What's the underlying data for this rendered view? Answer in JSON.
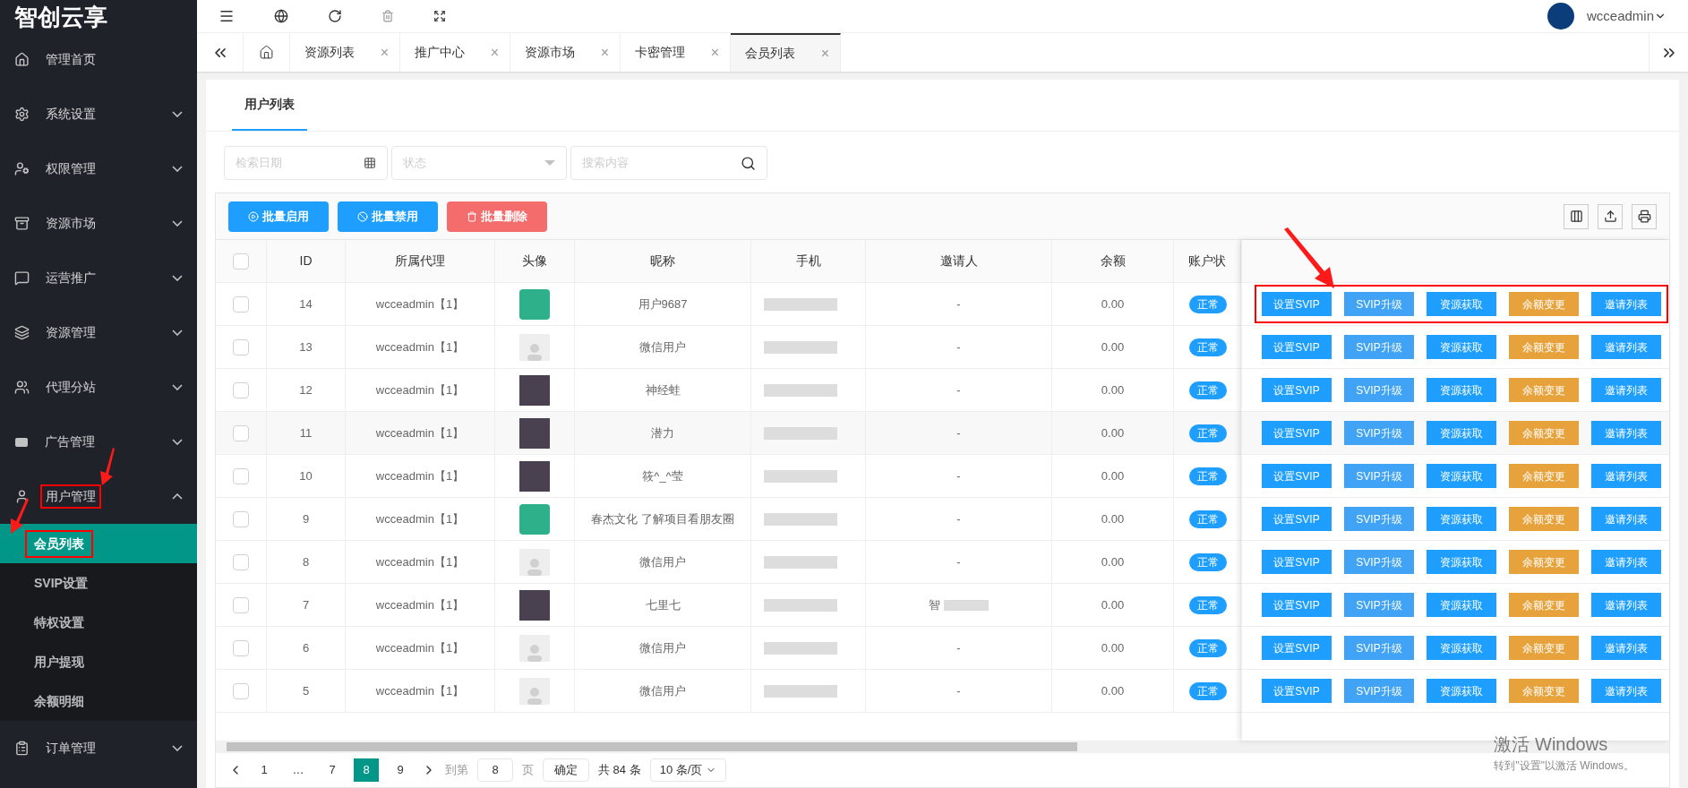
{
  "brand": {
    "name": "智创云享"
  },
  "user": {
    "name": "wcceadmin"
  },
  "sidebar": {
    "items": [
      {
        "label": "管理首页",
        "highlighted": false
      },
      {
        "label": "系统设置",
        "expandable": true,
        "expanded": false,
        "highlighted": false
      },
      {
        "label": "权限管理",
        "expandable": true,
        "expanded": false,
        "highlighted": false
      },
      {
        "label": "资源市场",
        "expandable": true,
        "expanded": false,
        "highlighted": false
      },
      {
        "label": "运营推广",
        "expandable": true,
        "expanded": false,
        "highlighted": false
      },
      {
        "label": "资源管理",
        "expandable": true,
        "expanded": false,
        "highlighted": false
      },
      {
        "label": "代理分站",
        "expandable": true,
        "expanded": false,
        "highlighted": false
      },
      {
        "label": "广告管理",
        "expandable": true,
        "expanded": false,
        "highlighted": false
      },
      {
        "label": "用户管理",
        "expandable": true,
        "expanded": true,
        "highlighted": true,
        "children": [
          {
            "label": "会员列表",
            "selected": true,
            "highlighted": true
          },
          {
            "label": "SVIP设置",
            "selected": false,
            "highlighted": false
          },
          {
            "label": "特权设置",
            "selected": false,
            "highlighted": false
          },
          {
            "label": "用户提现",
            "selected": false,
            "highlighted": false
          },
          {
            "label": "余额明细",
            "selected": false,
            "highlighted": false
          }
        ]
      },
      {
        "label": "订单管理",
        "expandable": true,
        "expanded": false,
        "highlighted": false
      }
    ]
  },
  "tabs": [
    {
      "label": "资源列表",
      "selected": false
    },
    {
      "label": "推广中心",
      "selected": false
    },
    {
      "label": "资源市场",
      "selected": false
    },
    {
      "label": "卡密管理",
      "selected": false
    },
    {
      "label": "会员列表",
      "selected": true
    }
  ],
  "close_glyph": "×",
  "subtabs": [
    {
      "label": "用户列表",
      "selected": true
    }
  ],
  "filters": {
    "date": {
      "placeholder": "检索日期"
    },
    "status": {
      "placeholder": "状态"
    },
    "search": {
      "placeholder": "搜索内容"
    }
  },
  "bulk_buttons": [
    {
      "label": "批量启用",
      "kind": "enable",
      "color": "#1e9fff"
    },
    {
      "label": "批量禁用",
      "kind": "disable",
      "color": "#1e9fff"
    },
    {
      "label": "批量删除",
      "kind": "delete",
      "color": "#f56c6c"
    }
  ],
  "table": {
    "all_checked": false,
    "columns": [
      "ID",
      "所属代理",
      "头像",
      "昵称",
      "手机",
      "邀请人",
      "余额",
      "账户状"
    ],
    "rows": [
      {
        "checked": false,
        "id": "14",
        "agent": "wcceadmin【1】",
        "avatar": {
          "kind": "logo"
        },
        "nickname": "用户9687",
        "inviter": "-",
        "inviter_hidden": false,
        "balance": "0.00",
        "status": "正常",
        "highlighted": true,
        "actions": [
          {
            "label": "设置SVIP",
            "color": "#1e9fff"
          },
          {
            "label": "SVIP升级",
            "color": "#40a3f5"
          },
          {
            "label": "资源获取",
            "color": "#1e9fff"
          },
          {
            "label": "余额变更",
            "color": "#e8a23c"
          },
          {
            "label": "邀请列表",
            "color": "#1e9fff"
          }
        ]
      },
      {
        "checked": false,
        "id": "13",
        "agent": "wcceadmin【1】",
        "avatar": {
          "kind": "default"
        },
        "nickname": "微信用户",
        "inviter": "-",
        "inviter_hidden": false,
        "balance": "0.00",
        "status": "正常",
        "highlighted": false,
        "actions": [
          {
            "label": "设置SVIP",
            "color": "#1e9fff"
          },
          {
            "label": "SVIP升级",
            "color": "#40a3f5"
          },
          {
            "label": "资源获取",
            "color": "#1e9fff"
          },
          {
            "label": "余额变更",
            "color": "#e8a23c"
          },
          {
            "label": "邀请列表",
            "color": "#1e9fff"
          }
        ]
      },
      {
        "checked": false,
        "id": "12",
        "agent": "wcceadmin【1】",
        "avatar": {
          "kind": "photo"
        },
        "nickname": "神经蛙",
        "inviter": "-",
        "inviter_hidden": false,
        "balance": "0.00",
        "status": "正常",
        "highlighted": false,
        "actions": [
          {
            "label": "设置SVIP",
            "color": "#1e9fff"
          },
          {
            "label": "SVIP升级",
            "color": "#40a3f5"
          },
          {
            "label": "资源获取",
            "color": "#1e9fff"
          },
          {
            "label": "余额变更",
            "color": "#e8a23c"
          },
          {
            "label": "邀请列表",
            "color": "#1e9fff"
          }
        ]
      },
      {
        "checked": false,
        "id": "11",
        "agent": "wcceadmin【1】",
        "avatar": {
          "kind": "photo"
        },
        "nickname": "潜力",
        "inviter": "-",
        "inviter_hidden": false,
        "balance": "0.00",
        "status": "正常",
        "highlighted": false,
        "actions": [
          {
            "label": "设置SVIP",
            "color": "#1e9fff"
          },
          {
            "label": "SVIP升级",
            "color": "#40a3f5"
          },
          {
            "label": "资源获取",
            "color": "#1e9fff"
          },
          {
            "label": "余额变更",
            "color": "#e8a23c"
          },
          {
            "label": "邀请列表",
            "color": "#1e9fff"
          }
        ]
      },
      {
        "checked": false,
        "id": "10",
        "agent": "wcceadmin【1】",
        "avatar": {
          "kind": "photo"
        },
        "nickname": "筱^_^莹",
        "inviter": "-",
        "inviter_hidden": false,
        "balance": "0.00",
        "status": "正常",
        "highlighted": false,
        "actions": [
          {
            "label": "设置SVIP",
            "color": "#1e9fff"
          },
          {
            "label": "SVIP升级",
            "color": "#40a3f5"
          },
          {
            "label": "资源获取",
            "color": "#1e9fff"
          },
          {
            "label": "余额变更",
            "color": "#e8a23c"
          },
          {
            "label": "邀请列表",
            "color": "#1e9fff"
          }
        ]
      },
      {
        "checked": false,
        "id": "9",
        "agent": "wcceadmin【1】",
        "avatar": {
          "kind": "logo"
        },
        "nickname": "春杰文化 了解项目看朋友圈",
        "inviter": "-",
        "inviter_hidden": false,
        "balance": "0.00",
        "status": "正常",
        "highlighted": false,
        "actions": [
          {
            "label": "设置SVIP",
            "color": "#1e9fff"
          },
          {
            "label": "SVIP升级",
            "color": "#40a3f5"
          },
          {
            "label": "资源获取",
            "color": "#1e9fff"
          },
          {
            "label": "余额变更",
            "color": "#e8a23c"
          },
          {
            "label": "邀请列表",
            "color": "#1e9fff"
          }
        ]
      },
      {
        "checked": false,
        "id": "8",
        "agent": "wcceadmin【1】",
        "avatar": {
          "kind": "default"
        },
        "nickname": "微信用户",
        "inviter": "-",
        "inviter_hidden": false,
        "balance": "0.00",
        "status": "正常",
        "highlighted": false,
        "actions": [
          {
            "label": "设置SVIP",
            "color": "#1e9fff"
          },
          {
            "label": "SVIP升级",
            "color": "#40a3f5"
          },
          {
            "label": "资源获取",
            "color": "#1e9fff"
          },
          {
            "label": "余额变更",
            "color": "#e8a23c"
          },
          {
            "label": "邀请列表",
            "color": "#1e9fff"
          }
        ]
      },
      {
        "checked": false,
        "id": "7",
        "agent": "wcceadmin【1】",
        "avatar": {
          "kind": "photo"
        },
        "nickname": "七里七",
        "inviter": "智",
        "inviter_hidden": true,
        "balance": "0.00",
        "status": "正常",
        "highlighted": false,
        "actions": [
          {
            "label": "设置SVIP",
            "color": "#1e9fff"
          },
          {
            "label": "SVIP升级",
            "color": "#40a3f5"
          },
          {
            "label": "资源获取",
            "color": "#1e9fff"
          },
          {
            "label": "余额变更",
            "color": "#e8a23c"
          },
          {
            "label": "邀请列表",
            "color": "#1e9fff"
          }
        ]
      },
      {
        "checked": false,
        "id": "6",
        "agent": "wcceadmin【1】",
        "avatar": {
          "kind": "default"
        },
        "nickname": "微信用户",
        "inviter": "-",
        "inviter_hidden": false,
        "balance": "0.00",
        "status": "正常",
        "highlighted": false,
        "actions": [
          {
            "label": "设置SVIP",
            "color": "#1e9fff"
          },
          {
            "label": "SVIP升级",
            "color": "#40a3f5"
          },
          {
            "label": "资源获取",
            "color": "#1e9fff"
          },
          {
            "label": "余额变更",
            "color": "#e8a23c"
          },
          {
            "label": "邀请列表",
            "color": "#1e9fff"
          }
        ]
      },
      {
        "checked": false,
        "id": "5",
        "agent": "wcceadmin【1】",
        "avatar": {
          "kind": "default"
        },
        "nickname": "微信用户",
        "inviter": "-",
        "inviter_hidden": false,
        "balance": "0.00",
        "status": "正常",
        "highlighted": false,
        "actions": [
          {
            "label": "设置SVIP",
            "color": "#1e9fff"
          },
          {
            "label": "SVIP升级",
            "color": "#40a3f5"
          },
          {
            "label": "资源获取",
            "color": "#1e9fff"
          },
          {
            "label": "余额变更",
            "color": "#e8a23c"
          },
          {
            "label": "邀请列表",
            "color": "#1e9fff"
          }
        ]
      }
    ]
  },
  "pagination": {
    "pages": [
      {
        "label": "1",
        "selected": false
      },
      {
        "label": "…",
        "selected": false
      },
      {
        "label": "7",
        "selected": false
      },
      {
        "label": "8",
        "selected": true
      },
      {
        "label": "9",
        "selected": false
      }
    ],
    "goto_label": "到第",
    "goto_value": "8",
    "page_unit": "页",
    "confirm": "确定",
    "total": "共 84 条",
    "page_size": "10 条/页"
  },
  "activation_notice": {
    "title": "激活 Windows",
    "text": "转到\"设置\"以激活 Windows。"
  }
}
